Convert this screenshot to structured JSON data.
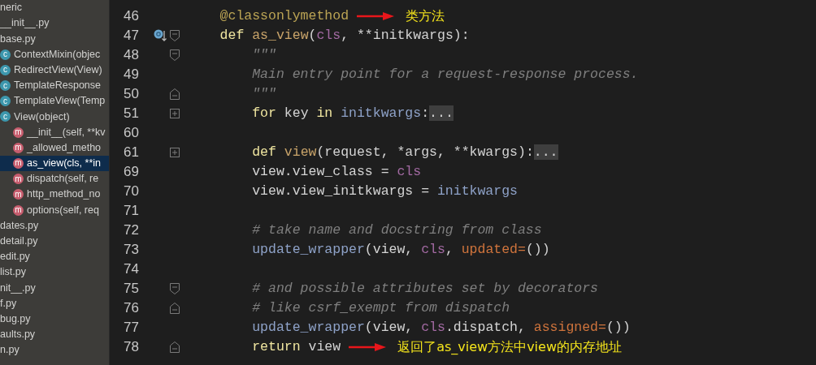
{
  "project_tree": [
    {
      "name": "neric",
      "selected": false,
      "children": [
        {
          "name": "__init__.py",
          "selected": false
        },
        {
          "name": "base.py",
          "selected": false,
          "children": [
            {
              "name": "ContextMixin(objec",
              "kind": "class",
              "badge": "c",
              "selected": false
            },
            {
              "name": "RedirectView(View)",
              "kind": "class",
              "badge": "c",
              "selected": false
            },
            {
              "name": "TemplateResponse",
              "kind": "class",
              "badge": "c",
              "selected": false
            },
            {
              "name": "TemplateView(Temp",
              "kind": "class",
              "badge": "c",
              "selected": false
            },
            {
              "name": "View(object)",
              "kind": "class",
              "badge": "c",
              "selected": false,
              "children": [
                {
                  "name": "__init__(self, **kv",
                  "kind": "method",
                  "badge": "m",
                  "selected": false
                },
                {
                  "name": "_allowed_metho",
                  "kind": "method",
                  "badge": "m",
                  "selected": false
                },
                {
                  "name": "as_view(cls, **in",
                  "kind": "method",
                  "badge": "m",
                  "selected": true
                },
                {
                  "name": "dispatch(self, re",
                  "kind": "method",
                  "badge": "m",
                  "selected": false
                },
                {
                  "name": "http_method_no",
                  "kind": "method",
                  "badge": "m",
                  "selected": false
                },
                {
                  "name": "options(self, req",
                  "kind": "method",
                  "badge": "m",
                  "selected": false
                }
              ]
            }
          ]
        },
        {
          "name": "dates.py",
          "selected": false
        },
        {
          "name": "detail.py",
          "selected": false
        },
        {
          "name": "edit.py",
          "selected": false
        },
        {
          "name": "list.py",
          "selected": false
        }
      ]
    },
    {
      "name": "nit__.py",
      "selected": false
    },
    {
      "name": "f.py",
      "selected": false
    },
    {
      "name": "bug.py",
      "selected": false
    },
    {
      "name": "aults.py",
      "selected": false
    },
    {
      "name": "n.py",
      "selected": false
    }
  ],
  "editor": {
    "lines": [
      {
        "number": "46",
        "tokens": [
          {
            "text": "    @classonlymethod",
            "kind": "decorator"
          }
        ],
        "annotation": "类方法"
      },
      {
        "number": "47",
        "fold": {
          "kind": "start"
        },
        "marker": {
          "kind": "override"
        },
        "tokens": [
          {
            "text": "    def ",
            "kind": "keyword"
          },
          {
            "text": "as_view",
            "kind": "funcname"
          },
          {
            "text": "(",
            "kind": "plain"
          },
          {
            "text": "cls",
            "kind": "self"
          },
          {
            "text": ", **initkwargs):",
            "kind": "plain"
          }
        ]
      },
      {
        "number": "48",
        "fold": {
          "kind": "start"
        },
        "tokens": [
          {
            "text": "        \"\"\"",
            "kind": "doc"
          }
        ]
      },
      {
        "number": "49",
        "tokens": [
          {
            "text": "        Main entry point for a request-response process.",
            "kind": "doc"
          }
        ]
      },
      {
        "number": "50",
        "fold": {
          "kind": "end"
        },
        "tokens": [
          {
            "text": "        \"\"\"",
            "kind": "doc"
          }
        ]
      },
      {
        "number": "51",
        "fold": {
          "kind": "expand"
        },
        "tokens": [
          {
            "text": "        for",
            "kind": "keyword"
          },
          {
            "text": " key ",
            "kind": "plain"
          },
          {
            "text": "in ",
            "kind": "keyword"
          },
          {
            "text": "initkwargs",
            "kind": "ref"
          },
          {
            "text": ":",
            "kind": "plain"
          },
          {
            "text": "...",
            "kind": "folded"
          }
        ]
      },
      {
        "number": "60"
      },
      {
        "number": "61",
        "fold": {
          "kind": "expand"
        },
        "tokens": [
          {
            "text": "        def ",
            "kind": "keyword"
          },
          {
            "text": "view",
            "kind": "funcname"
          },
          {
            "text": "(request, *args, **kwargs):",
            "kind": "plain"
          },
          {
            "text": "...",
            "kind": "folded"
          }
        ]
      },
      {
        "number": "69",
        "tokens": [
          {
            "text": "        view.view_class = ",
            "kind": "plain"
          },
          {
            "text": "cls",
            "kind": "self"
          }
        ]
      },
      {
        "number": "70",
        "tokens": [
          {
            "text": "        view.view_initkwargs = ",
            "kind": "plain"
          },
          {
            "text": "initkwargs",
            "kind": "ref"
          }
        ]
      },
      {
        "number": "71"
      },
      {
        "number": "72",
        "tokens": [
          {
            "text": "        # take name and docstring from class",
            "kind": "comment"
          }
        ]
      },
      {
        "number": "73",
        "tokens": [
          {
            "text": "        update_wrapper",
            "kind": "call"
          },
          {
            "text": "(view, ",
            "kind": "plain"
          },
          {
            "text": "cls",
            "kind": "self"
          },
          {
            "text": ", ",
            "kind": "plain"
          },
          {
            "text": "updated=",
            "kind": "named"
          },
          {
            "text": "())",
            "kind": "plain"
          }
        ]
      },
      {
        "number": "74"
      },
      {
        "number": "75",
        "fold": {
          "kind": "start"
        },
        "tokens": [
          {
            "text": "        # and possible attributes set by decorators",
            "kind": "comment"
          }
        ]
      },
      {
        "number": "76",
        "fold": {
          "kind": "end"
        },
        "tokens": [
          {
            "text": "        # like csrf_exempt from dispatch",
            "kind": "comment"
          }
        ]
      },
      {
        "number": "77",
        "tokens": [
          {
            "text": "        update_wrapper",
            "kind": "call"
          },
          {
            "text": "(view, ",
            "kind": "plain"
          },
          {
            "text": "cls",
            "kind": "self"
          },
          {
            "text": ".dispatch, ",
            "kind": "plain"
          },
          {
            "text": "assigned=",
            "kind": "named"
          },
          {
            "text": "())",
            "kind": "plain"
          }
        ]
      },
      {
        "number": "78",
        "fold": {
          "kind": "end"
        },
        "tokens": [
          {
            "text": "        return",
            "kind": "keyword"
          },
          {
            "text": " view",
            "kind": "plain"
          }
        ],
        "annotation": "返回了as_view方法中view的内存地址"
      }
    ]
  }
}
